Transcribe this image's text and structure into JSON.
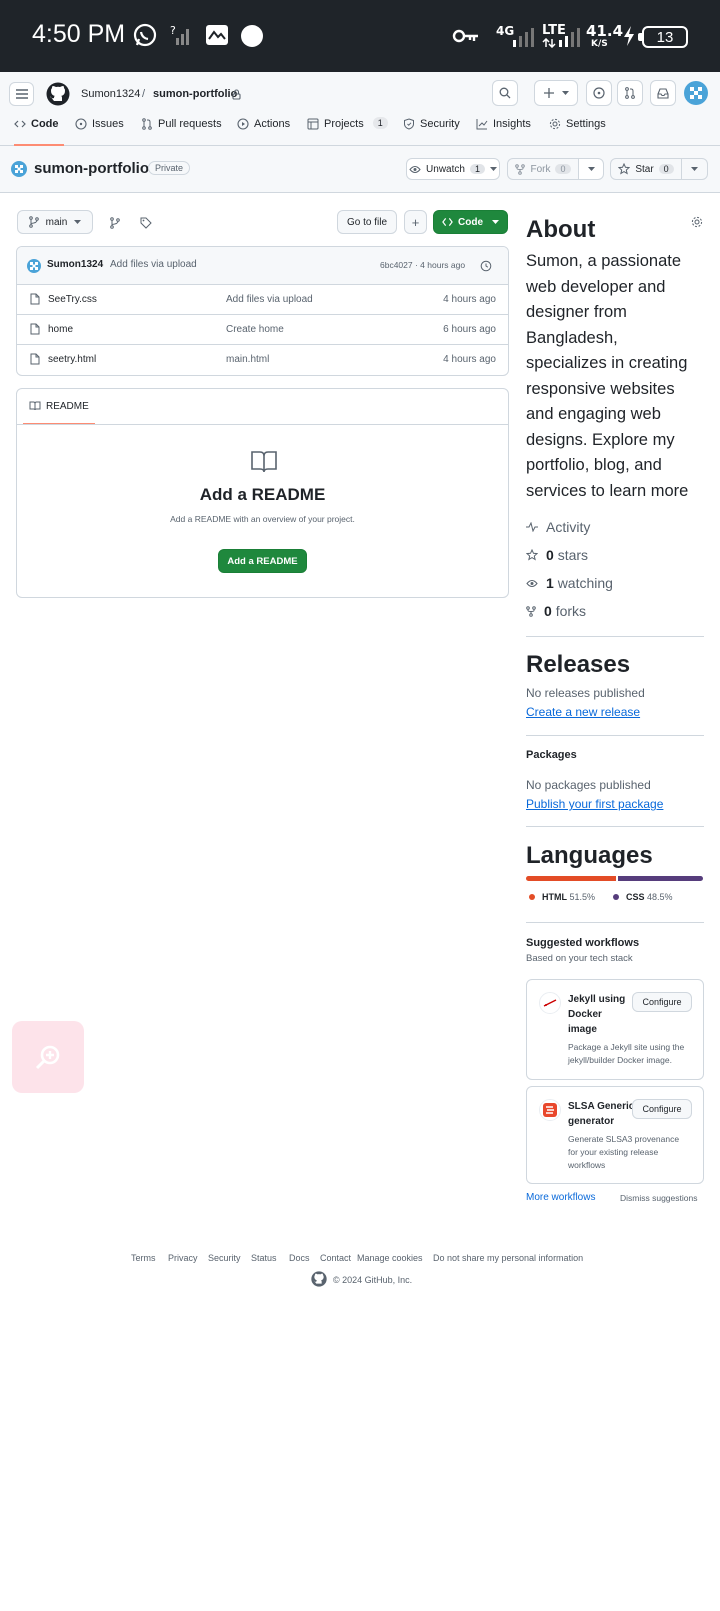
{
  "status_bar": {
    "time": "4:50 PM",
    "net_4g": "4G",
    "net_lte": "LTE",
    "speed_value": "41.4",
    "speed_unit": "K/S",
    "battery": "13"
  },
  "header": {
    "owner": "Sumon1324",
    "separator": "/",
    "repo": "sumon-portfolio"
  },
  "tabs": [
    {
      "label": "Code"
    },
    {
      "label": "Issues"
    },
    {
      "label": "Pull requests"
    },
    {
      "label": "Actions"
    },
    {
      "label": "Projects",
      "count": "1"
    },
    {
      "label": "Security"
    },
    {
      "label": "Insights"
    },
    {
      "label": "Settings"
    }
  ],
  "repo": {
    "name": "sumon-portfolio",
    "visibility": "Private",
    "unwatch_label": "Unwatch",
    "unwatch_count": "1",
    "fork_label": "Fork",
    "fork_count": "0",
    "star_label": "Star",
    "star_count": "0"
  },
  "toolbar": {
    "branch": "main",
    "go_to_file": "Go to file",
    "add": "+",
    "code": "Code"
  },
  "commit": {
    "author": "Sumon1324",
    "message": "Add files via upload",
    "meta": "6bc4027 · 4 hours ago"
  },
  "files": [
    {
      "name": "SeeTry.css",
      "message": "Add files via upload",
      "age": "4 hours ago"
    },
    {
      "name": "home",
      "message": "Create home",
      "age": "6 hours ago"
    },
    {
      "name": "seetry.html",
      "message": "main.html",
      "age": "4 hours ago"
    }
  ],
  "readme": {
    "tab": "README",
    "title": "Add a README",
    "subtitle": "Add a README with an overview of your project.",
    "button": "Add a README"
  },
  "about": {
    "title": "About",
    "description_lines": [
      "Sumon, a passionate",
      "web developer and",
      "designer from",
      "Bangladesh,",
      "specializes in creating",
      "responsive websites",
      "and engaging web",
      "designs. Explore my",
      "portfolio, blog, and",
      "services to learn more"
    ],
    "activity": "Activity",
    "stars_count": "0",
    "stars_label": "stars",
    "watching_count": "1",
    "watching_label": "watching",
    "forks_count": "0",
    "forks_label": "forks"
  },
  "releases": {
    "title": "Releases",
    "empty": "No releases published",
    "link": "Create a new release"
  },
  "packages": {
    "title": "Packages",
    "empty": "No packages published",
    "link": "Publish your first package"
  },
  "languages": {
    "title": "Languages",
    "items": [
      {
        "name": "HTML",
        "percent": "51.5%",
        "value": 51.5,
        "color": "#e34c26"
      },
      {
        "name": "CSS",
        "percent": "48.5%",
        "value": 48.5,
        "color": "#563d7c"
      }
    ]
  },
  "workflows": {
    "title": "Suggested workflows",
    "subtitle": "Based on your tech stack",
    "items": [
      {
        "title_lines": [
          "Jekyll using",
          "Docker",
          "image"
        ],
        "desc_lines": [
          "Package a Jekyll site using the",
          "jekyll/builder Docker image."
        ],
        "button": "Configure"
      },
      {
        "title_lines": [
          "SLSA Generic",
          "generator"
        ],
        "desc_lines": [
          "Generate SLSA3 provenance",
          "for your existing release",
          "workflows"
        ],
        "button": "Configure"
      }
    ],
    "more": "More workflows",
    "dismiss": "Dismiss suggestions"
  },
  "footer": {
    "links": [
      "Terms",
      "Privacy",
      "Security",
      "Status",
      "Docs",
      "Contact",
      "Manage cookies",
      "Do not share my personal information"
    ],
    "copyright": "© 2024 GitHub, Inc."
  },
  "colors": {
    "accent_green": "#1f883d",
    "link_blue": "#0969da",
    "tab_underline": "#fd8c73"
  }
}
